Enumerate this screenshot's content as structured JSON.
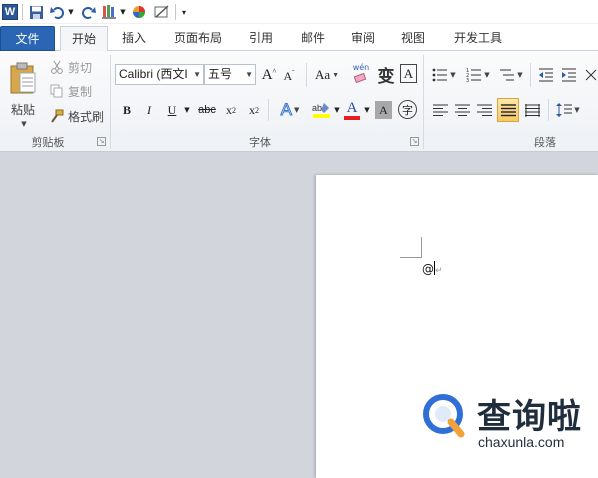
{
  "qat": {
    "word_logo": "W"
  },
  "tabs": [
    {
      "label": "文件"
    },
    {
      "label": "开始"
    },
    {
      "label": "插入"
    },
    {
      "label": "页面布局"
    },
    {
      "label": "引用"
    },
    {
      "label": "邮件"
    },
    {
      "label": "审阅"
    },
    {
      "label": "视图"
    },
    {
      "label": "开发工具"
    }
  ],
  "clipboard": {
    "paste": "粘贴",
    "cut": "剪切",
    "copy": "复制",
    "format_painter": "格式刷",
    "group_label": "剪贴板"
  },
  "font": {
    "font_name": "Calibri (西文I",
    "font_size": "五号",
    "grow": "A",
    "shrink": "A",
    "change_case": "Aa",
    "bold": "B",
    "italic": "I",
    "underline": "U",
    "strike": "abc",
    "subscript": "x",
    "superscript": "x",
    "sub_mark": "2",
    "sup_mark": "2",
    "font_color": "A",
    "char_shading": "A",
    "phonetic": "变",
    "enclose": "字",
    "char_border": "A",
    "wen": "wén",
    "group_label": "字体"
  },
  "paragraph": {
    "group_label": "段落"
  },
  "document": {
    "text": "@"
  },
  "watermark": {
    "title": "查询啦",
    "url": "chaxunla.com"
  },
  "colors": {
    "file_tab": "#2b66b5",
    "workarea": "#d2d6dc",
    "highlight": "#ffff00",
    "font_red": "#e02020",
    "watermark_blue": "#2f6fd6",
    "watermark_orange": "#f2a23a"
  }
}
